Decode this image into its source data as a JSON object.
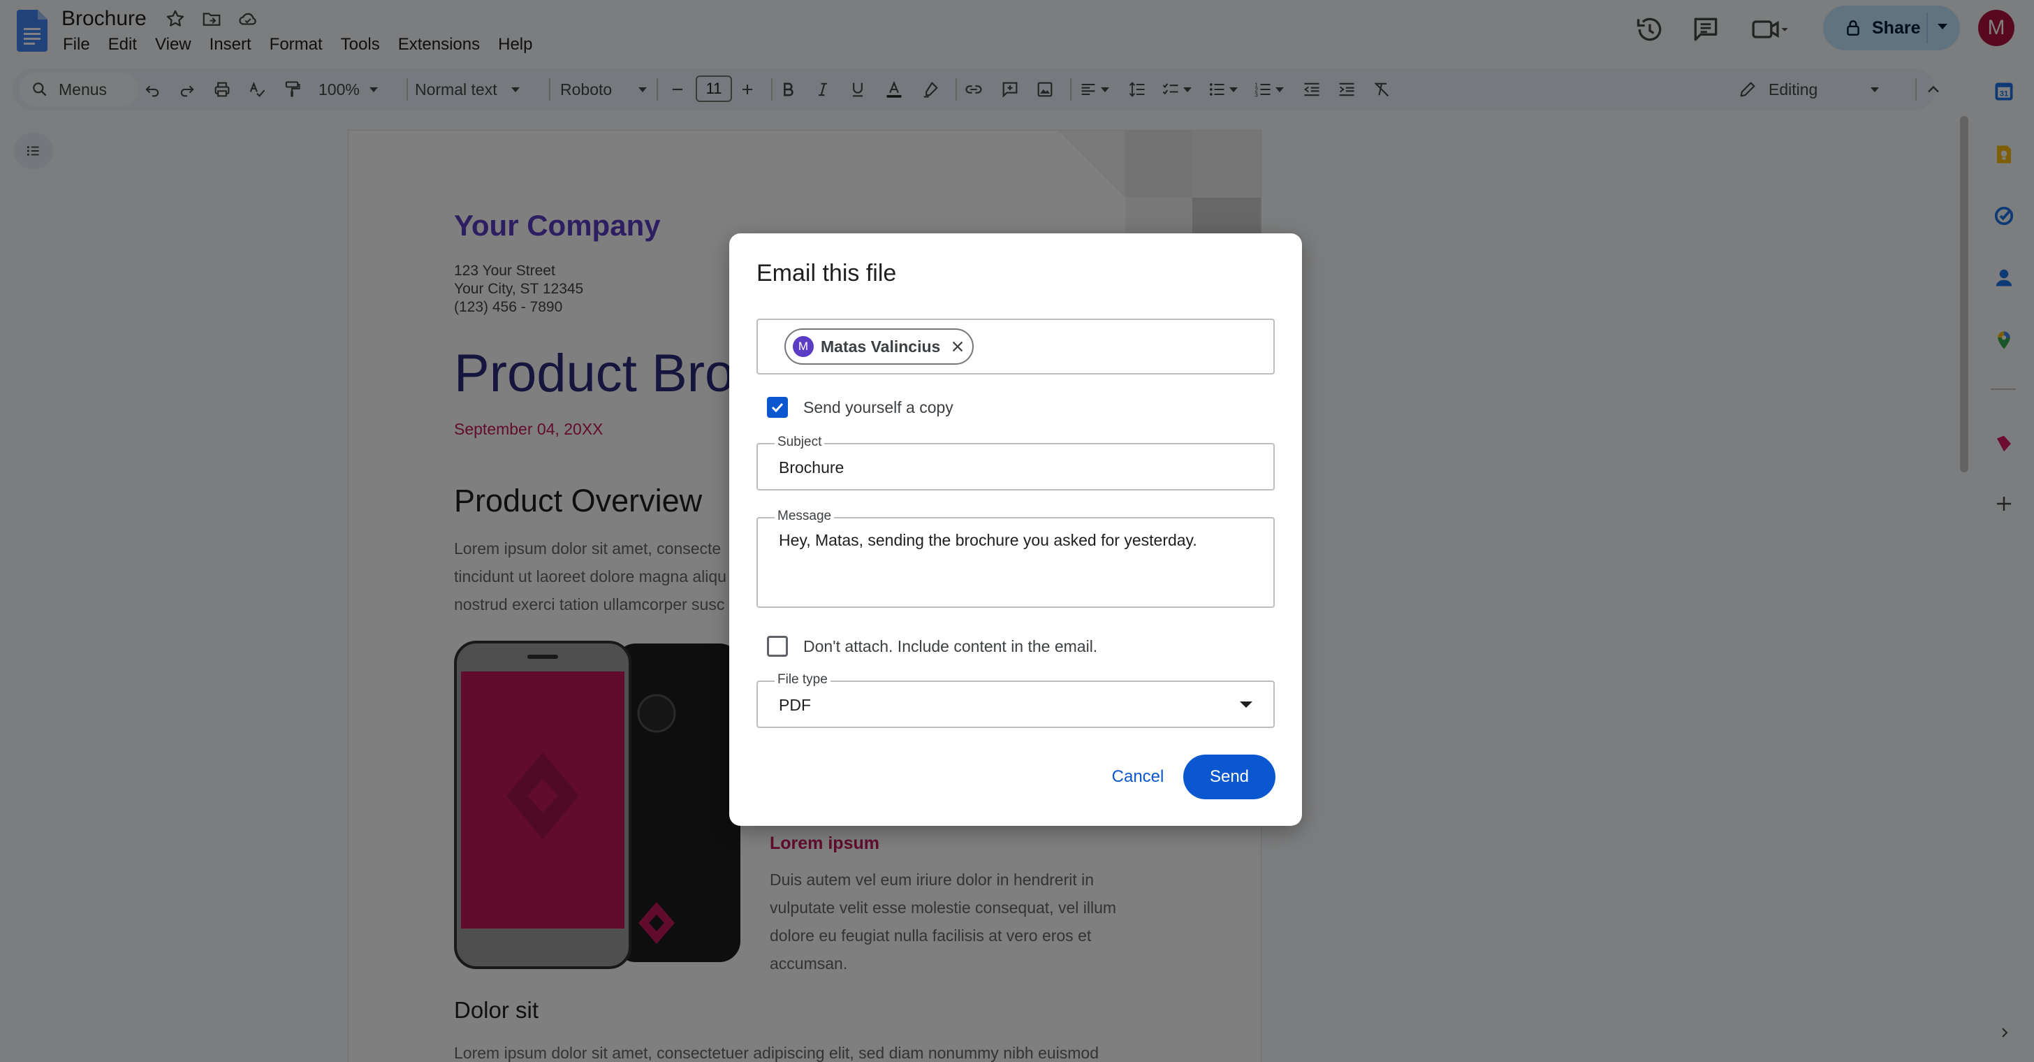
{
  "app": {
    "doc_title": "Brochure",
    "menu": [
      "File",
      "Edit",
      "View",
      "Insert",
      "Format",
      "Tools",
      "Extensions",
      "Help"
    ],
    "share_label": "Share",
    "user_initial": "M"
  },
  "toolbar": {
    "search_label": "Menus",
    "zoom": "100%",
    "style": "Normal text",
    "font": "Roboto",
    "font_size": "11",
    "mode": "Editing"
  },
  "document": {
    "company": "Your Company",
    "address": [
      "123 Your Street",
      "Your City, ST 12345",
      "(123) 456 - 7890"
    ],
    "title": "Product Broc",
    "date": "September 04, 20XX",
    "overview_heading": "Product Overview",
    "overview_lines": [
      "Lorem ipsum dolor sit amet, consecte",
      "tincidunt ut laoreet dolore magna aliqu",
      "nostrud exerci tation ullamcorper susc"
    ],
    "lorem_heading": "Lorem ipsum",
    "lorem_lines": [
      "Duis autem vel eum iriure dolor in hendrerit in",
      "vulputate velit esse molestie consequat, vel illum",
      "dolore eu feugiat nulla facilisis at vero eros et",
      "accumsan."
    ],
    "dolor_heading": "Dolor sit",
    "dolor_line": "Lorem ipsum dolor sit amet, consectetuer adipiscing elit, sed diam nonummy nibh euismod"
  },
  "dialog": {
    "title": "Email this file",
    "recipient": {
      "initial": "M",
      "name": "Matas Valincius"
    },
    "send_copy_label": "Send yourself a copy",
    "send_copy_checked": true,
    "subject_label": "Subject",
    "subject_value": "Brochure",
    "message_label": "Message",
    "message_value": "Hey, Matas, sending the brochure you asked for yesterday.",
    "dont_attach_label": "Don't attach. Include content in the email.",
    "dont_attach_checked": false,
    "file_type_label": "File type",
    "file_type_value": "PDF",
    "cancel_label": "Cancel",
    "send_label": "Send"
  },
  "colors": {
    "accent": "#0b57d0",
    "share_bg": "#c2e7ff",
    "company": "#5b3cc4",
    "date": "#c2185b",
    "avatar": "#b3123f"
  }
}
